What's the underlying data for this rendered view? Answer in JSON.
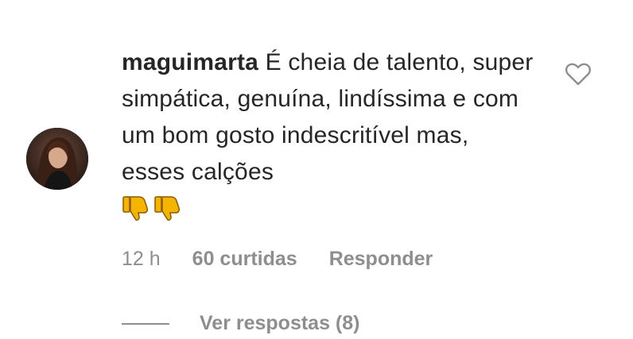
{
  "comment": {
    "username": "maguimarta",
    "text": "É cheia de talento, super simpática, genuína, lindíssima e com um bom gosto indescritível mas, esses calções",
    "emoji": [
      "thumbs-down-emoji",
      "thumbs-down-emoji"
    ],
    "accent_emoji_color": "#f4b400"
  },
  "meta": {
    "time": "12 h",
    "likes": "60 curtidas",
    "reply": "Responder"
  },
  "replies": {
    "label": "Ver respostas (8)"
  },
  "icons": {
    "like": "heart-outline-icon",
    "avatar": "user-avatar"
  }
}
